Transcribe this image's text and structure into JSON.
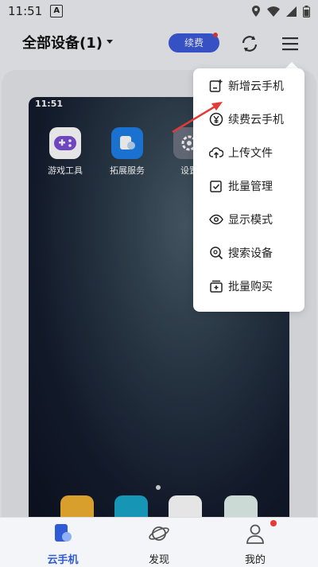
{
  "status": {
    "time": "11:51"
  },
  "header": {
    "title": "全部设备(1)",
    "renew_label": "续费"
  },
  "phone": {
    "time": "11:51",
    "apps": [
      {
        "label": "游戏工具"
      },
      {
        "label": "拓展服务"
      },
      {
        "label": "设置"
      }
    ]
  },
  "menu": {
    "items": [
      {
        "label": "新增云手机",
        "icon": "add-device-icon"
      },
      {
        "label": "续费云手机",
        "icon": "yen-icon"
      },
      {
        "label": "上传文件",
        "icon": "upload-cloud-icon"
      },
      {
        "label": "批量管理",
        "icon": "batch-check-icon"
      },
      {
        "label": "显示模式",
        "icon": "eye-icon"
      },
      {
        "label": "搜索设备",
        "icon": "search-device-icon"
      },
      {
        "label": "批量购买",
        "icon": "batch-buy-icon"
      }
    ]
  },
  "tabs": [
    {
      "label": "云手机"
    },
    {
      "label": "发现"
    },
    {
      "label": "我的"
    }
  ],
  "colors": {
    "accent": "#3b5bdb",
    "arrow": "#e53935"
  }
}
